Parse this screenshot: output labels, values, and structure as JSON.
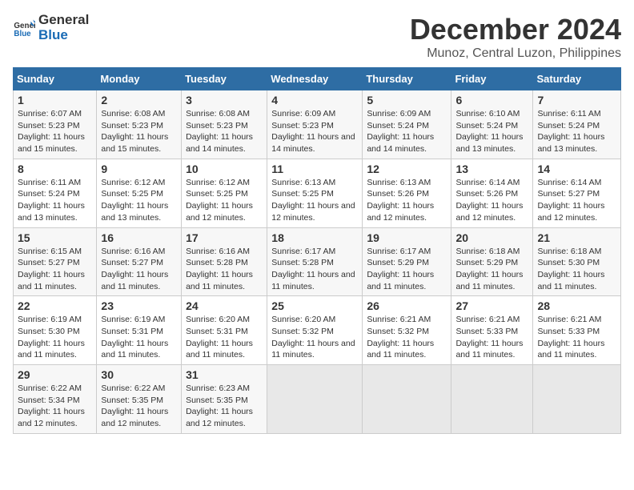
{
  "logo": {
    "general": "General",
    "blue": "Blue"
  },
  "title": "December 2024",
  "subtitle": "Munoz, Central Luzon, Philippines",
  "days_header": [
    "Sunday",
    "Monday",
    "Tuesday",
    "Wednesday",
    "Thursday",
    "Friday",
    "Saturday"
  ],
  "weeks": [
    [
      {
        "day": 1,
        "sunrise": "6:07 AM",
        "sunset": "5:23 PM",
        "daylight": "11 hours and 15 minutes."
      },
      {
        "day": 2,
        "sunrise": "6:08 AM",
        "sunset": "5:23 PM",
        "daylight": "11 hours and 15 minutes."
      },
      {
        "day": 3,
        "sunrise": "6:08 AM",
        "sunset": "5:23 PM",
        "daylight": "11 hours and 14 minutes."
      },
      {
        "day": 4,
        "sunrise": "6:09 AM",
        "sunset": "5:23 PM",
        "daylight": "11 hours and 14 minutes."
      },
      {
        "day": 5,
        "sunrise": "6:09 AM",
        "sunset": "5:24 PM",
        "daylight": "11 hours and 14 minutes."
      },
      {
        "day": 6,
        "sunrise": "6:10 AM",
        "sunset": "5:24 PM",
        "daylight": "11 hours and 13 minutes."
      },
      {
        "day": 7,
        "sunrise": "6:11 AM",
        "sunset": "5:24 PM",
        "daylight": "11 hours and 13 minutes."
      }
    ],
    [
      {
        "day": 8,
        "sunrise": "6:11 AM",
        "sunset": "5:24 PM",
        "daylight": "11 hours and 13 minutes."
      },
      {
        "day": 9,
        "sunrise": "6:12 AM",
        "sunset": "5:25 PM",
        "daylight": "11 hours and 13 minutes."
      },
      {
        "day": 10,
        "sunrise": "6:12 AM",
        "sunset": "5:25 PM",
        "daylight": "11 hours and 12 minutes."
      },
      {
        "day": 11,
        "sunrise": "6:13 AM",
        "sunset": "5:25 PM",
        "daylight": "11 hours and 12 minutes."
      },
      {
        "day": 12,
        "sunrise": "6:13 AM",
        "sunset": "5:26 PM",
        "daylight": "11 hours and 12 minutes."
      },
      {
        "day": 13,
        "sunrise": "6:14 AM",
        "sunset": "5:26 PM",
        "daylight": "11 hours and 12 minutes."
      },
      {
        "day": 14,
        "sunrise": "6:14 AM",
        "sunset": "5:27 PM",
        "daylight": "11 hours and 12 minutes."
      }
    ],
    [
      {
        "day": 15,
        "sunrise": "6:15 AM",
        "sunset": "5:27 PM",
        "daylight": "11 hours and 11 minutes."
      },
      {
        "day": 16,
        "sunrise": "6:16 AM",
        "sunset": "5:27 PM",
        "daylight": "11 hours and 11 minutes."
      },
      {
        "day": 17,
        "sunrise": "6:16 AM",
        "sunset": "5:28 PM",
        "daylight": "11 hours and 11 minutes."
      },
      {
        "day": 18,
        "sunrise": "6:17 AM",
        "sunset": "5:28 PM",
        "daylight": "11 hours and 11 minutes."
      },
      {
        "day": 19,
        "sunrise": "6:17 AM",
        "sunset": "5:29 PM",
        "daylight": "11 hours and 11 minutes."
      },
      {
        "day": 20,
        "sunrise": "6:18 AM",
        "sunset": "5:29 PM",
        "daylight": "11 hours and 11 minutes."
      },
      {
        "day": 21,
        "sunrise": "6:18 AM",
        "sunset": "5:30 PM",
        "daylight": "11 hours and 11 minutes."
      }
    ],
    [
      {
        "day": 22,
        "sunrise": "6:19 AM",
        "sunset": "5:30 PM",
        "daylight": "11 hours and 11 minutes."
      },
      {
        "day": 23,
        "sunrise": "6:19 AM",
        "sunset": "5:31 PM",
        "daylight": "11 hours and 11 minutes."
      },
      {
        "day": 24,
        "sunrise": "6:20 AM",
        "sunset": "5:31 PM",
        "daylight": "11 hours and 11 minutes."
      },
      {
        "day": 25,
        "sunrise": "6:20 AM",
        "sunset": "5:32 PM",
        "daylight": "11 hours and 11 minutes."
      },
      {
        "day": 26,
        "sunrise": "6:21 AM",
        "sunset": "5:32 PM",
        "daylight": "11 hours and 11 minutes."
      },
      {
        "day": 27,
        "sunrise": "6:21 AM",
        "sunset": "5:33 PM",
        "daylight": "11 hours and 11 minutes."
      },
      {
        "day": 28,
        "sunrise": "6:21 AM",
        "sunset": "5:33 PM",
        "daylight": "11 hours and 11 minutes."
      }
    ],
    [
      {
        "day": 29,
        "sunrise": "6:22 AM",
        "sunset": "5:34 PM",
        "daylight": "11 hours and 12 minutes."
      },
      {
        "day": 30,
        "sunrise": "6:22 AM",
        "sunset": "5:35 PM",
        "daylight": "11 hours and 12 minutes."
      },
      {
        "day": 31,
        "sunrise": "6:23 AM",
        "sunset": "5:35 PM",
        "daylight": "11 hours and 12 minutes."
      },
      null,
      null,
      null,
      null
    ]
  ]
}
